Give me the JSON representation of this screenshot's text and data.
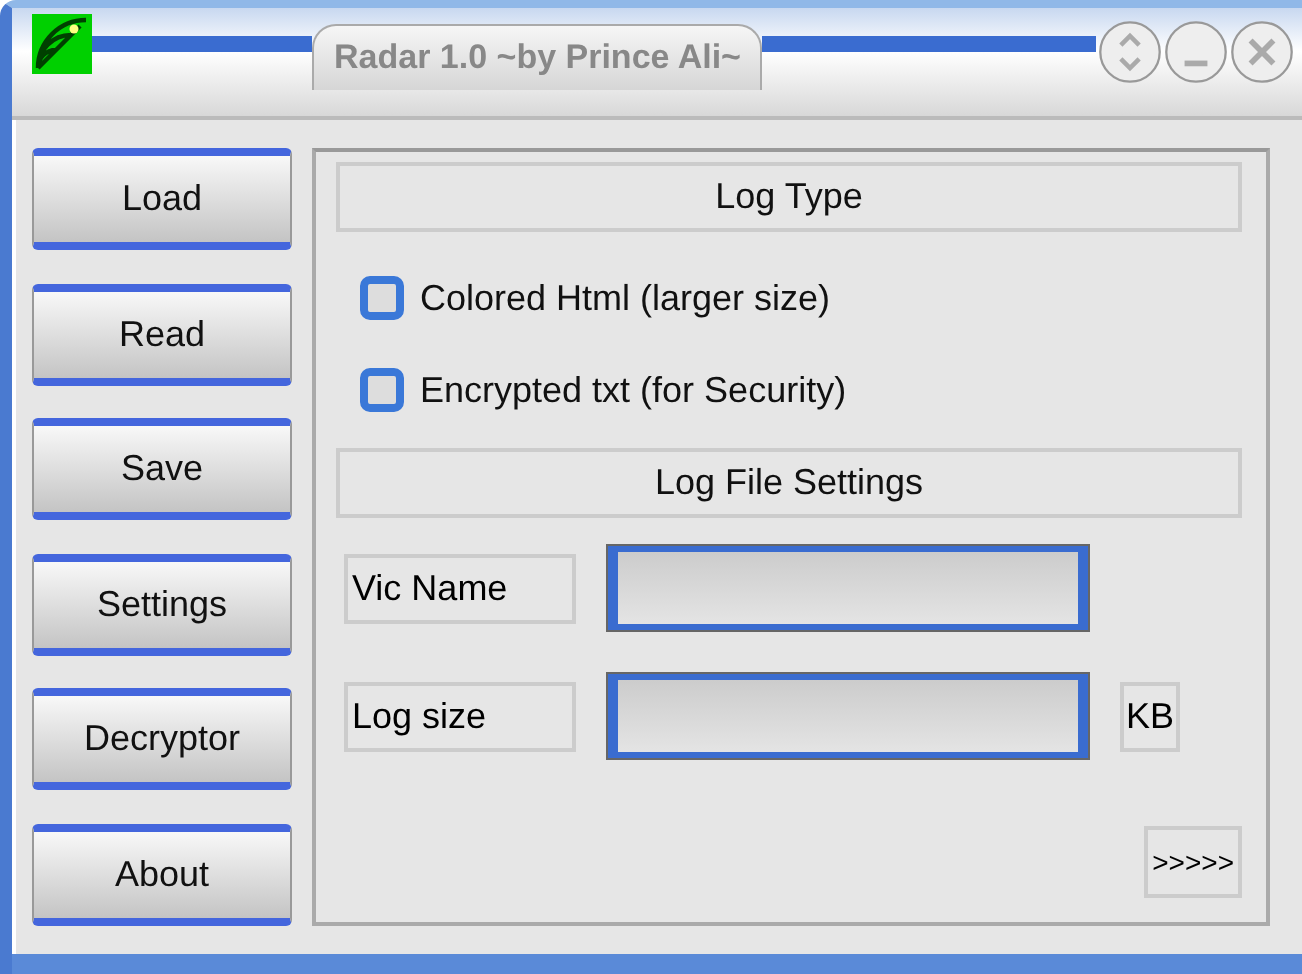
{
  "window": {
    "title": "Radar 1.0 ~by Prince Ali~"
  },
  "sidebar": {
    "buttons": [
      "Load",
      "Read",
      "Save",
      "Settings",
      "Decryptor",
      "About"
    ]
  },
  "log_type": {
    "header": "Log Type",
    "options": [
      {
        "label": "Colored Html (larger size)",
        "checked": false
      },
      {
        "label": "Encrypted txt (for Security)",
        "checked": false
      }
    ]
  },
  "log_file_settings": {
    "header": "Log File Settings",
    "fields": [
      {
        "label": "Vic Name"
      },
      {
        "label": "Log size",
        "unit": "KB"
      }
    ]
  },
  "next_button": ">>>>>"
}
